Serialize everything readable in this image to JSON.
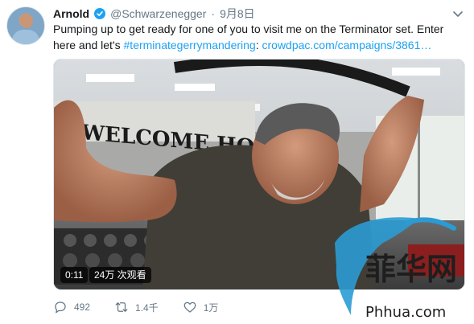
{
  "tweet": {
    "author_name": "Arnold",
    "handle": "@Schwarzenegger",
    "separator": "·",
    "date": "9月8日",
    "text_prefix": "Pumping up to get ready for one of you to visit me on the Terminator set. Enter here and let's ",
    "hashtag": "#terminategerrymandering",
    "text_colon": ": ",
    "link": "crowdpac.com/campaigns/3861…"
  },
  "video": {
    "duration": "0:11",
    "views": "24万 次观看",
    "sign_text": "WELCOME HOM"
  },
  "actions": {
    "replies": "492",
    "retweets": "1.4千",
    "likes": "1万"
  },
  "watermark": {
    "chinese": "菲华网",
    "site": "Phhua.com"
  },
  "colors": {
    "link_blue": "#1da1f2",
    "muted_gray": "#657786",
    "verified_blue": "#1da1f2"
  },
  "icons": {
    "verified": "verified-badge-icon",
    "more": "chevron-down-icon",
    "reply": "reply-icon",
    "retweet": "retweet-icon",
    "like": "heart-icon"
  }
}
